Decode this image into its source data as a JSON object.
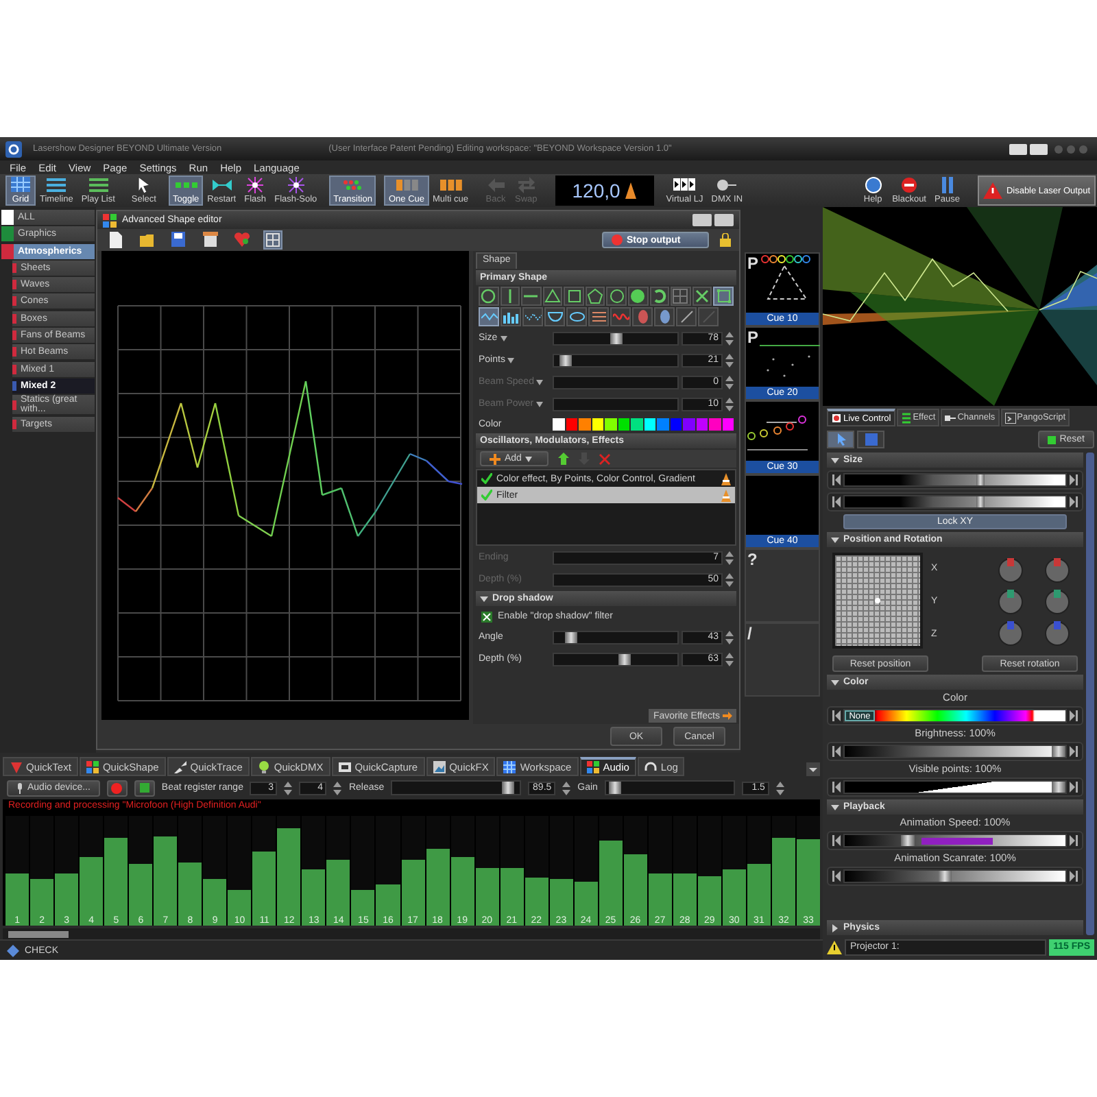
{
  "window": {
    "title": "Lasershow Designer BEYOND Ultimate Version",
    "subtitle": "(User Interface Patent Pending) Editing workspace: \"BEYOND Workspace Version 1.0\""
  },
  "menu": [
    "File",
    "Edit",
    "View",
    "Page",
    "Settings",
    "Run",
    "Help",
    "Language"
  ],
  "toolbar_left": [
    [
      {
        "label": "Grid",
        "selected": true,
        "disabled": false
      },
      {
        "label": "Timeline",
        "selected": false,
        "disabled": false
      },
      {
        "label": "Play List",
        "selected": false,
        "disabled": false
      }
    ],
    [
      {
        "label": "Select",
        "selected": false,
        "disabled": false
      }
    ],
    [
      {
        "label": "Toggle",
        "selected": true,
        "disabled": false
      },
      {
        "label": "Restart",
        "selected": false,
        "disabled": false
      },
      {
        "label": "Flash",
        "selected": false,
        "disabled": false
      },
      {
        "label": "Flash-Solo",
        "selected": false,
        "disabled": false
      }
    ],
    [
      {
        "label": "Transition",
        "selected": true,
        "disabled": false
      }
    ],
    [
      {
        "label": "One Cue",
        "selected": true,
        "disabled": false
      },
      {
        "label": "Multi cue",
        "selected": false,
        "disabled": false
      }
    ],
    [
      {
        "label": "Back",
        "selected": false,
        "disabled": true
      },
      {
        "label": "Swap",
        "selected": false,
        "disabled": true
      }
    ]
  ],
  "tempo": {
    "value": "120,0"
  },
  "toolbar_io": [
    "Virtual LJ",
    "DMX IN"
  ],
  "toolbar_right": [
    "Help",
    "Blackout",
    "Pause"
  ],
  "output_button": "Disable Laser Output",
  "categories": [
    {
      "label": "ALL",
      "color": "#ffffff",
      "selected": false
    },
    {
      "label": "Graphics",
      "color": "#1e8c3c",
      "selected": false
    },
    {
      "label": "Atmospherics",
      "color": "#d02a3e",
      "selected": true,
      "children": [
        {
          "label": "Sheets",
          "color": "#d02a3e",
          "selected": false
        },
        {
          "label": "Waves",
          "color": "#d02a3e",
          "selected": false
        },
        {
          "label": "Cones",
          "color": "#d02a3e",
          "selected": false
        },
        {
          "label": "Boxes",
          "color": "#d02a3e",
          "selected": false
        },
        {
          "label": "Fans of Beams",
          "color": "#d02a3e",
          "selected": false
        },
        {
          "label": "Hot Beams",
          "color": "#d02a3e",
          "selected": false
        },
        {
          "label": "Mixed 1",
          "color": "#d02a3e",
          "selected": false
        },
        {
          "label": "Mixed 2",
          "color": "#3a5ab0",
          "selected": true
        },
        {
          "label": "Statics (great with...",
          "color": "#d02a3e",
          "selected": false
        },
        {
          "label": "Targets",
          "color": "#d02a3e",
          "selected": false
        }
      ]
    }
  ],
  "shape_editor": {
    "title": "Advanced Shape editor",
    "stop_button": "Stop output",
    "tab": "Shape",
    "primary_header": "Primary Shape",
    "tool_rows": [
      [
        {
          "selected": false
        },
        {
          "selected": false
        },
        {
          "selected": false
        },
        {
          "selected": false
        },
        {
          "selected": false
        },
        {
          "selected": false
        },
        {
          "selected": false
        },
        {
          "selected": false
        },
        {
          "selected": false
        },
        {
          "selected": false
        },
        {
          "selected": false
        },
        {
          "selected": true
        }
      ],
      [
        {
          "selected": true
        },
        {
          "selected": false
        },
        {
          "selected": false
        },
        {
          "selected": false
        },
        {
          "selected": false
        },
        {
          "selected": false
        },
        {
          "selected": false
        },
        {
          "selected": false
        },
        {
          "selected": false
        },
        {
          "selected": false
        },
        {
          "selected": false
        }
      ]
    ],
    "params": [
      {
        "kind": "menu-slider",
        "label": "Size",
        "value": "78",
        "level": 0.5,
        "disabled": false
      },
      {
        "kind": "menu-slider",
        "label": "Points",
        "value": "21",
        "level": 0.05,
        "disabled": false
      },
      {
        "kind": "menu-slider",
        "label": "Beam Speed",
        "value": "0",
        "disabled": true
      },
      {
        "kind": "menu-slider",
        "label": "Beam Power",
        "value": "10",
        "disabled": true
      }
    ],
    "color_label": "Color",
    "colors": [
      {
        "color": "#ffffff"
      },
      {
        "color": "#ff0000"
      },
      {
        "color": "#ff8000"
      },
      {
        "color": "#ffff00"
      },
      {
        "color": "#80ff00"
      },
      {
        "color": "#00e000"
      },
      {
        "color": "#00e080"
      },
      {
        "color": "#00ffff"
      },
      {
        "color": "#0080ff"
      },
      {
        "color": "#0000ff"
      },
      {
        "color": "#8000ff"
      },
      {
        "color": "#c000ff"
      },
      {
        "color": "#ff00c0"
      },
      {
        "color": "#ff00ff"
      }
    ],
    "effects_header": "Oscillators, Modulators, Effects",
    "add_button": "Add",
    "effects": [
      {
        "label": "Color effect, By Points, Color Control, Gradient",
        "checked": true,
        "selected": false
      },
      {
        "label": "Filter",
        "checked": true,
        "selected": true
      }
    ],
    "filter_params": [
      {
        "kind": "field",
        "label": "Ending",
        "value": "7",
        "disabled": true
      },
      {
        "kind": "field",
        "label": "Depth (%)",
        "value": "50",
        "disabled": true
      }
    ],
    "drop_shadow": {
      "header": "Drop shadow",
      "expanded": true,
      "enable_label": "Enable \"drop shadow\" filter",
      "enabled": true,
      "params": [
        {
          "kind": "slider",
          "label": "Angle",
          "value": "43",
          "level": 0.1,
          "disabled": false
        },
        {
          "kind": "slider",
          "label": "Depth (%)",
          "value": "63",
          "level": 0.58,
          "disabled": false
        }
      ]
    },
    "favorites_tab": "Favorite Effects",
    "buttons": [
      "OK",
      "Cancel"
    ]
  },
  "cues": [
    {
      "kind": "triangle",
      "title": "P",
      "label": "Cue 10"
    },
    {
      "kind": "dots",
      "title": "P",
      "label": "Cue 20"
    },
    {
      "kind": "circles",
      "label": "Cue 30"
    },
    {
      "kind": "blank",
      "label": "Cue 40"
    },
    {
      "kind": "empty",
      "title": "?"
    },
    {
      "kind": "empty",
      "title": "/"
    }
  ],
  "live_control": {
    "tabs": [
      {
        "label": "Live Control",
        "selected": true
      },
      {
        "label": "Effect",
        "selected": false
      },
      {
        "label": "Channels",
        "selected": false
      },
      {
        "label": "PangoScript",
        "selected": false
      }
    ],
    "reset": "Reset",
    "size": {
      "header": "Size",
      "expanded": true,
      "sliders": [
        {
          "level": 0.62
        },
        {
          "level": 0.62
        }
      ],
      "lock_button": "Lock XY"
    },
    "position": {
      "header": "Position and Rotation",
      "expanded": true,
      "axes": [
        {
          "label": "X",
          "color": "#c83838"
        },
        {
          "label": "Y",
          "color": "#2e9a70"
        },
        {
          "label": "Z",
          "color": "#3a50d0"
        }
      ],
      "reset_position": "Reset position",
      "reset_rotation": "Reset rotation"
    },
    "color": {
      "header": "Color",
      "expanded": true,
      "label": "Color",
      "thumb": "None",
      "level": 0,
      "brightness": {
        "label": "Brightness: 100%",
        "level": 1
      },
      "visible": {
        "label": "Visible points: 100%",
        "level": 1
      }
    },
    "playback": {
      "header": "Playback",
      "expanded": true,
      "speed": {
        "label": "Animation Speed: 100%",
        "level": 0.27
      },
      "scanrate": {
        "label": "Animation Scanrate: 100%",
        "level": 0.45
      }
    },
    "physics": {
      "header": "Physics",
      "expanded": false
    },
    "projector": "Projector 1:",
    "fps": "115 FPS"
  },
  "bottom_tabs": [
    {
      "label": "QuickText",
      "selected": false
    },
    {
      "label": "QuickShape",
      "selected": false
    },
    {
      "label": "QuickTrace",
      "selected": false
    },
    {
      "label": "QuickDMX",
      "selected": false
    },
    {
      "label": "QuickCapture",
      "selected": false
    },
    {
      "label": "QuickFX",
      "selected": false
    },
    {
      "label": "Workspace",
      "selected": false
    },
    {
      "label": "Audio",
      "selected": true
    },
    {
      "label": "Log",
      "selected": false
    }
  ],
  "audio": {
    "device_button": "Audio device...",
    "beat_label": "Beat register range",
    "beat_from": "3",
    "beat_to": "4",
    "release": {
      "label": "Release",
      "value": "89.5",
      "level": 0.95
    },
    "gain": {
      "label": "Gain",
      "value": "1.5",
      "level": 0.02
    },
    "status": "Recording and processing \"Microfoon (High Definition Audi\"",
    "bands": [
      {
        "label": "1",
        "level": 0.48
      },
      {
        "label": "2",
        "level": 0.42
      },
      {
        "label": "3",
        "level": 0.47
      },
      {
        "label": "4",
        "level": 0.63
      },
      {
        "label": "5",
        "level": 0.8
      },
      {
        "label": "6",
        "level": 0.56
      },
      {
        "label": "7",
        "level": 0.81
      },
      {
        "label": "8",
        "level": 0.57
      },
      {
        "label": "9",
        "level": 0.43
      },
      {
        "label": "10",
        "level": 0.33
      },
      {
        "label": "11",
        "level": 0.67
      },
      {
        "label": "12",
        "level": 0.89
      },
      {
        "label": "13",
        "level": 0.51
      },
      {
        "label": "14",
        "level": 0.6
      },
      {
        "label": "15",
        "level": 0.32
      },
      {
        "label": "16",
        "level": 0.38
      },
      {
        "label": "17",
        "level": 0.6
      },
      {
        "label": "18",
        "level": 0.7
      },
      {
        "label": "19",
        "level": 0.62
      },
      {
        "label": "20",
        "level": 0.53
      },
      {
        "label": "21",
        "level": 0.52
      },
      {
        "label": "22",
        "level": 0.44
      },
      {
        "label": "23",
        "level": 0.42
      },
      {
        "label": "24",
        "level": 0.4
      },
      {
        "label": "25",
        "level": 0.77
      },
      {
        "label": "26",
        "level": 0.65
      },
      {
        "label": "27",
        "level": 0.47
      },
      {
        "label": "28",
        "level": 0.48
      },
      {
        "label": "29",
        "level": 0.45
      },
      {
        "label": "30",
        "level": 0.51
      },
      {
        "label": "31",
        "level": 0.56
      },
      {
        "label": "32",
        "level": 0.8
      },
      {
        "label": "33",
        "level": 0.79
      }
    ]
  },
  "status_bar": "CHECK"
}
